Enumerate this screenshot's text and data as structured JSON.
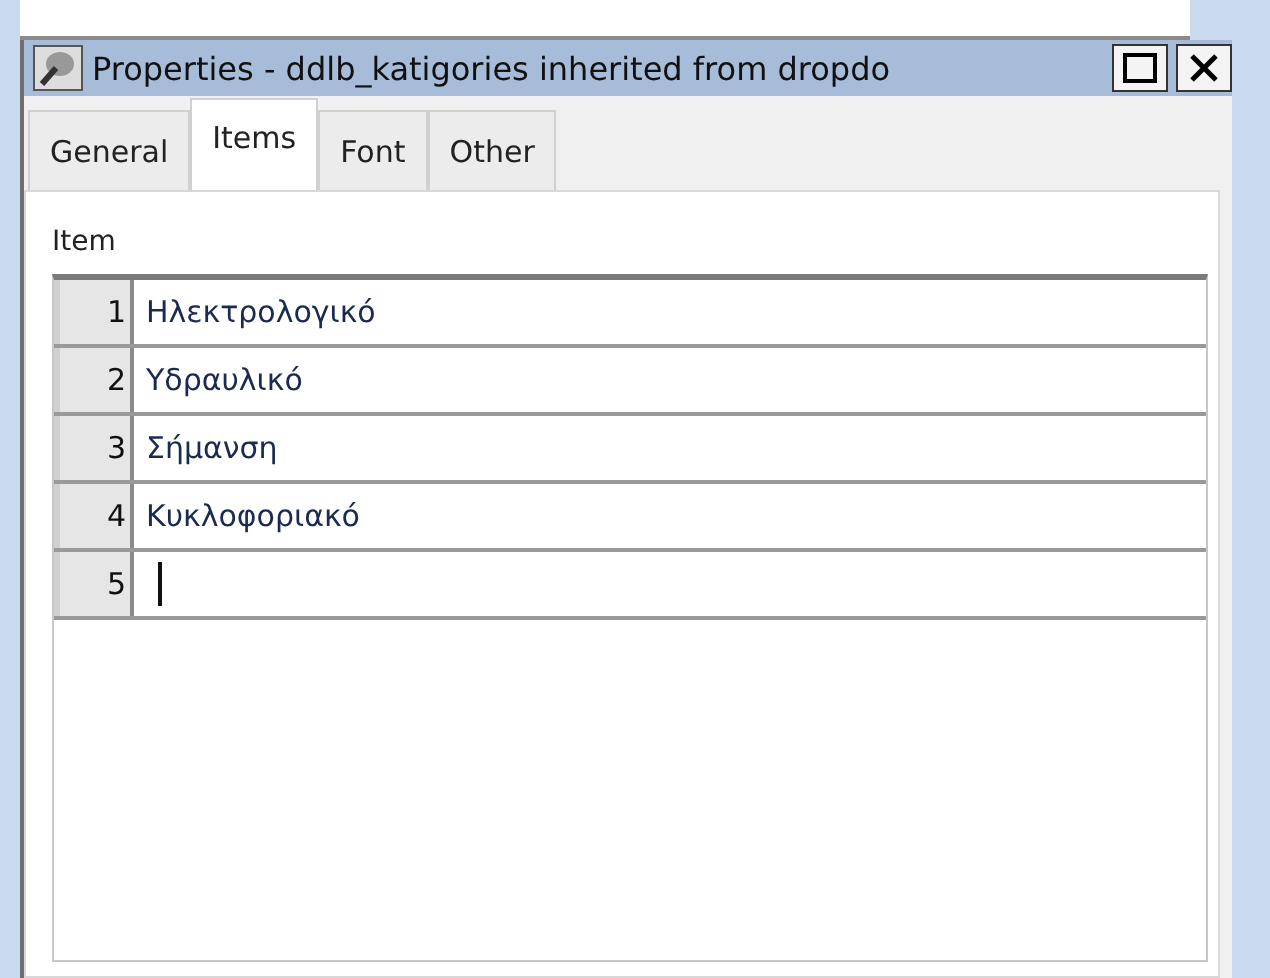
{
  "window": {
    "title": "Properties - ddlb_katigories inherited from dropdo"
  },
  "tabs": [
    {
      "label": "General",
      "selected": false
    },
    {
      "label": "Items",
      "selected": true
    },
    {
      "label": "Font",
      "selected": false
    },
    {
      "label": "Other",
      "selected": false
    }
  ],
  "items_grid": {
    "label": "Item",
    "rows": [
      {
        "number": "1",
        "value": "Ηλεκτρολογικό",
        "editing": false
      },
      {
        "number": "2",
        "value": "Υδραυλικό",
        "editing": false
      },
      {
        "number": "3",
        "value": "Σήμανση",
        "editing": false
      },
      {
        "number": "4",
        "value": "Κυκλοφοριακό",
        "editing": false
      },
      {
        "number": "5",
        "editing": true
      }
    ]
  }
}
